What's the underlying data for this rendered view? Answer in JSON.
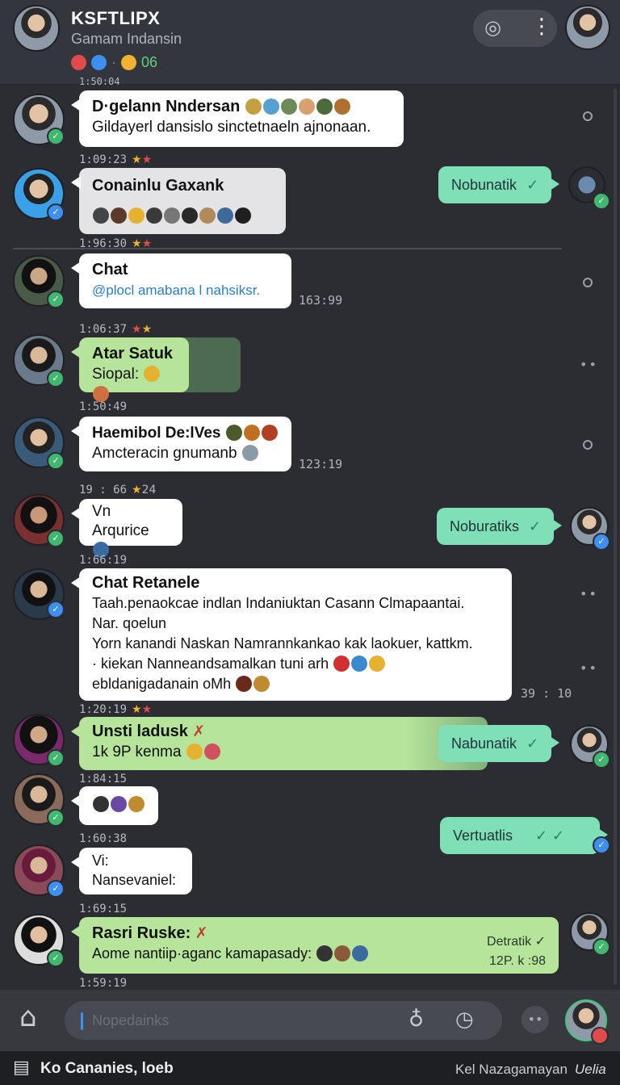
{
  "header": {
    "title": "KSFTLIPX",
    "subtitle": "Gamam Indansin",
    "status_count": "06",
    "status_colors": [
      "#e24b4b",
      "#3d8ff0",
      "#f2b230"
    ],
    "icons": [
      "target-icon",
      "more-vertical-icon"
    ]
  },
  "messages": [
    {
      "time": "1:09:23",
      "title": "D·gelann Nndersan",
      "text": "Gildayerl dansislo sinctetnaeln ajnonaan."
    },
    {
      "time": "1:96:30",
      "title": "Conainlu Gaxank"
    },
    {
      "time": "1:06:37",
      "title": "Chat",
      "text": "@plocl amabana l nahsiksr.",
      "side_time": "163:99"
    },
    {
      "time": "1:50:49",
      "title": "Atar Satuk",
      "text": "Siopal:"
    },
    {
      "time": "19 : 66",
      "stars_text": "24",
      "title": "Haemibol De:lVes",
      "text": "Amcteracin gnumanb",
      "side_time": "123:19"
    },
    {
      "time": "1:66:19",
      "title": "Vn",
      "text": "Arqurice"
    },
    {
      "time": "1:20:19",
      "title": "Chat Retanele",
      "lines": [
        "Taah.penaokcae indlan Indaniuktan Casann Clmapaantai.",
        "Nar. qoelun",
        "Yorn kanandi Naskan Namrannkankao kak laokuer, kattkm.",
        "· kiekan Nanneandsamalkan tuni arh",
        "ebldanigadanain oMh"
      ],
      "side_time": "39 : 10"
    },
    {
      "time": "1:84:15",
      "title": "Unsti ladusk",
      "text": "1k 9P kenma"
    },
    {
      "time": "1:60:38"
    },
    {
      "time": "1:69:15",
      "title": "Vi:",
      "text": "Nansevaniel:"
    },
    {
      "time": "1:59:19",
      "title": "Rasri Ruske:",
      "text": "Aome nantiip·aganc kamapasady:"
    }
  ],
  "outgoing": [
    {
      "text": "Nobunatik"
    },
    {
      "text": "Noburatiks"
    },
    {
      "text": "Nabunatik"
    },
    {
      "text": "Vertuatlis"
    },
    {
      "text": "Detratik",
      "sub": "12P. k :98"
    }
  ],
  "top_stamp": "1:50:04",
  "composer": {
    "placeholder": "Nopedainks"
  },
  "footer": {
    "left": "Ko Cananies, loeb",
    "mid": "Kel Nazagamayan",
    "right": "Uelia"
  }
}
